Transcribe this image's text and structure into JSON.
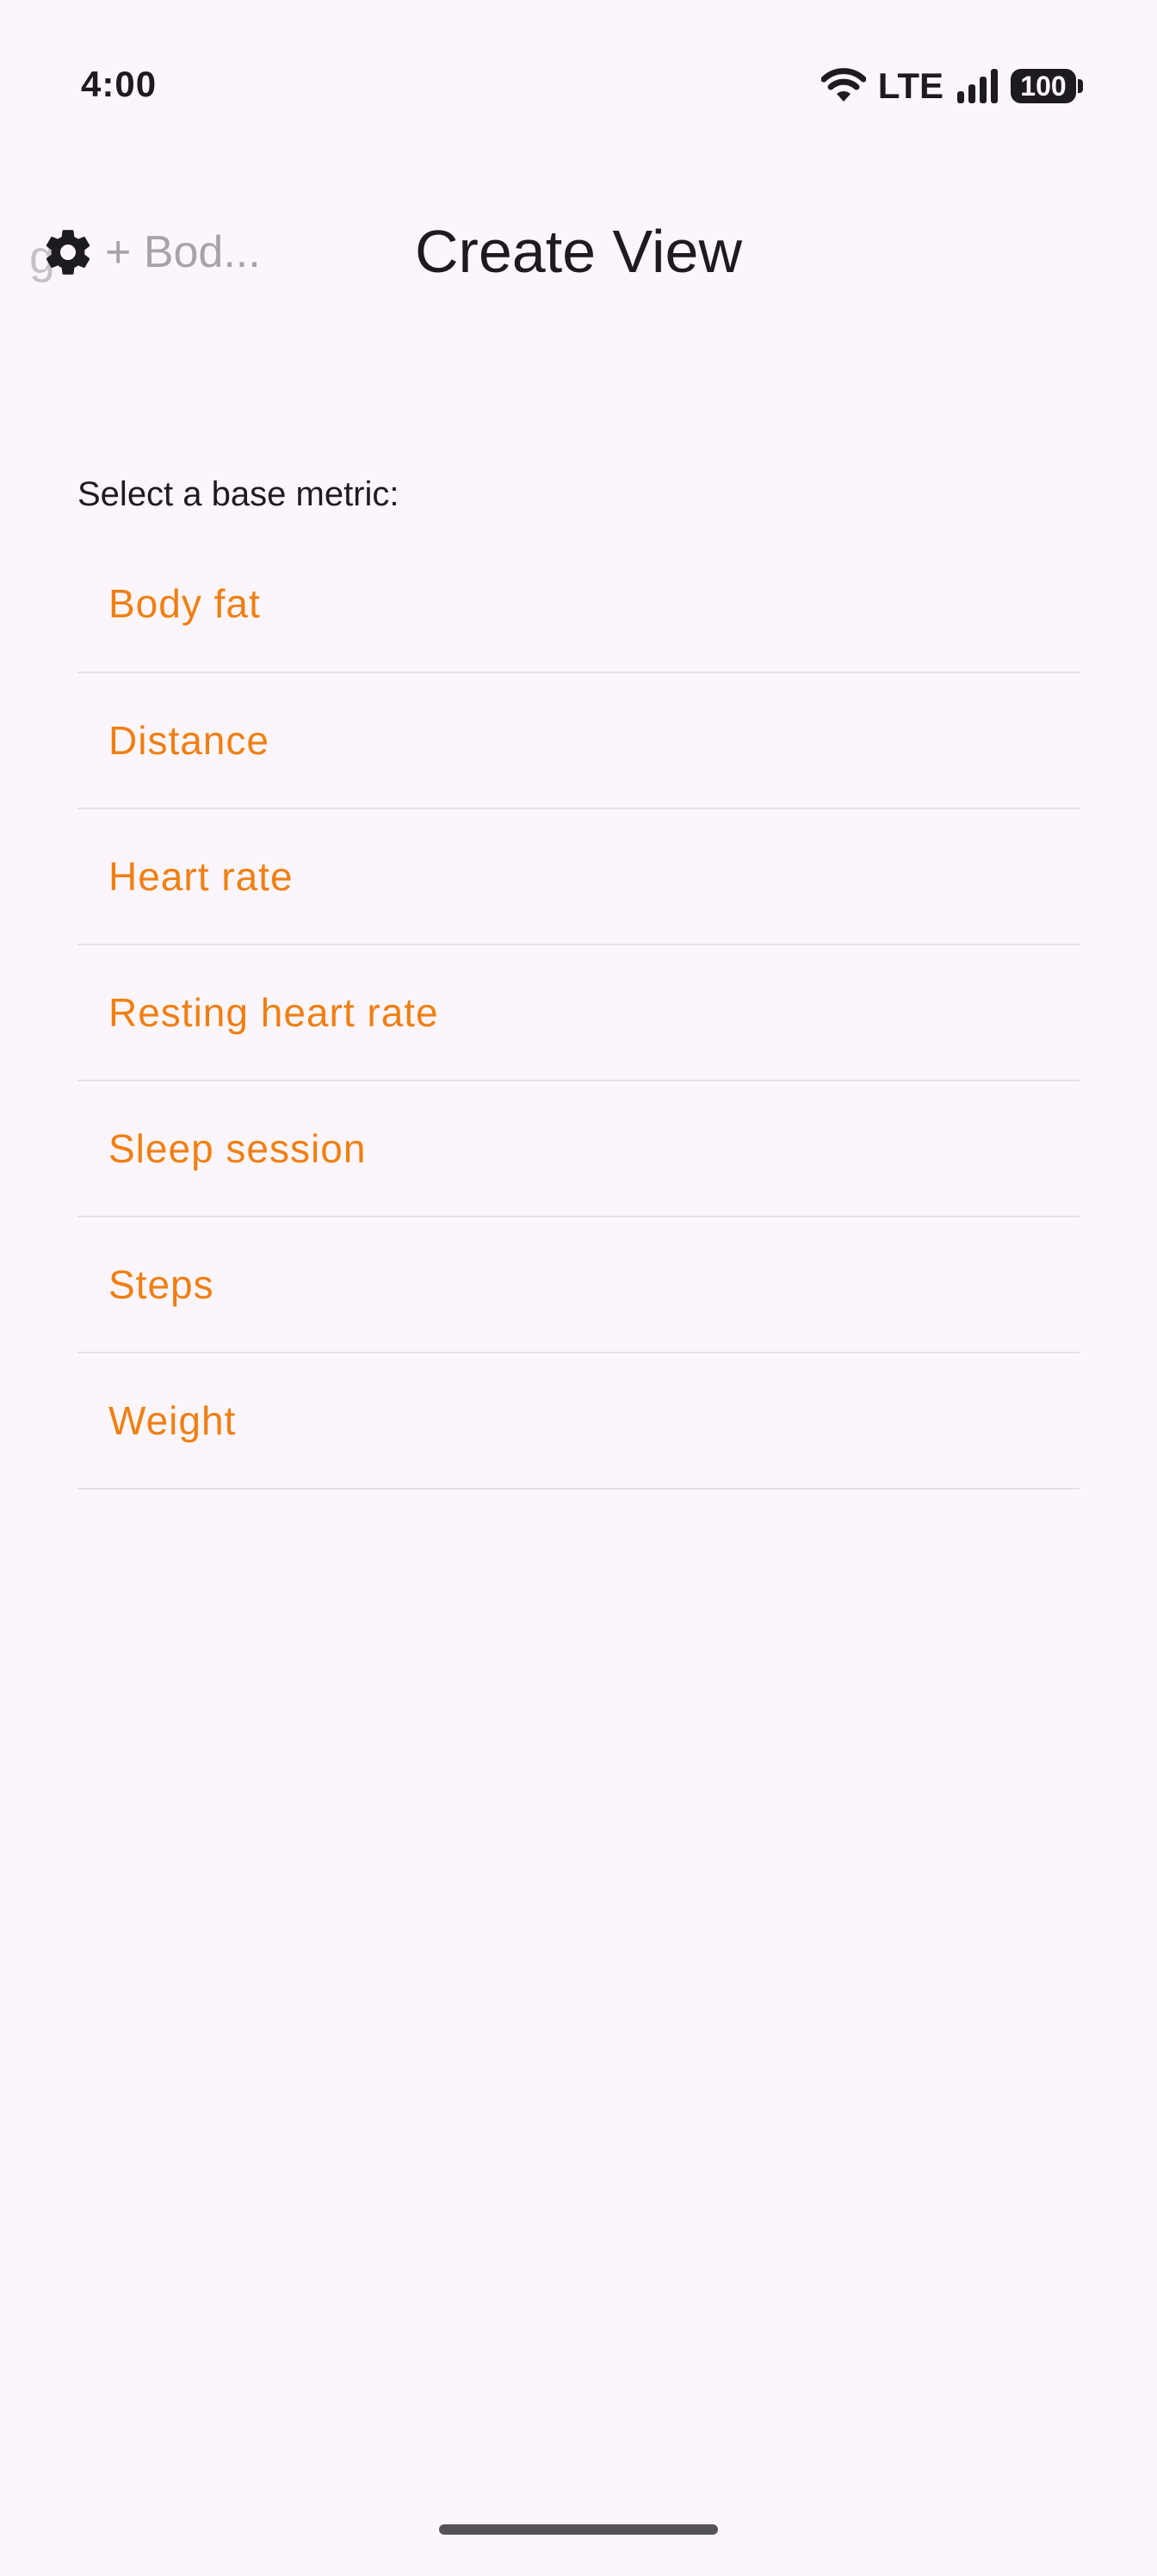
{
  "status_bar": {
    "time": "4:00",
    "network": "LTE",
    "battery": "100",
    "icons": [
      "wifi-icon",
      "signal-icon",
      "battery-icon"
    ]
  },
  "header": {
    "ghost_text": "g",
    "back_label": "+ Bod...",
    "title": "Create View",
    "settings_icon": "gear-icon"
  },
  "content": {
    "section_label": "Select a base metric:",
    "metrics": [
      {
        "label": "Body fat"
      },
      {
        "label": "Distance"
      },
      {
        "label": "Heart rate"
      },
      {
        "label": "Resting heart rate"
      },
      {
        "label": "Sleep session"
      },
      {
        "label": "Steps"
      },
      {
        "label": "Weight"
      }
    ]
  },
  "colors": {
    "accent": "#f07f12",
    "background": "#fcf6fc",
    "text": "#1d1b20",
    "divider": "#e6e0e6"
  }
}
